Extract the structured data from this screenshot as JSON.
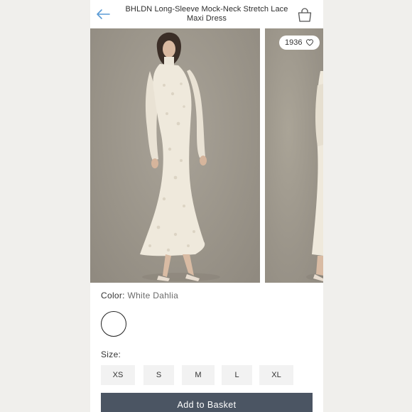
{
  "header": {
    "title": "BHLDN Long-Sleeve Mock-Neck Stretch Lace Maxi Dress",
    "back_icon": "back-arrow-icon",
    "bag_icon": "shopping-bag-icon"
  },
  "gallery": {
    "likes_count": "1936",
    "like_icon": "heart-outline-icon"
  },
  "color": {
    "label": "Color:",
    "value": "White Dahlia",
    "swatch_color": "#ffffff"
  },
  "size": {
    "label": "Size:",
    "options": [
      "XS",
      "S",
      "M",
      "L",
      "XL"
    ]
  },
  "cta": {
    "label": "Add to Basket",
    "color": "#4b5563"
  },
  "colors": {
    "accent": "#5b9bd5",
    "backdrop": "#9b958a"
  }
}
